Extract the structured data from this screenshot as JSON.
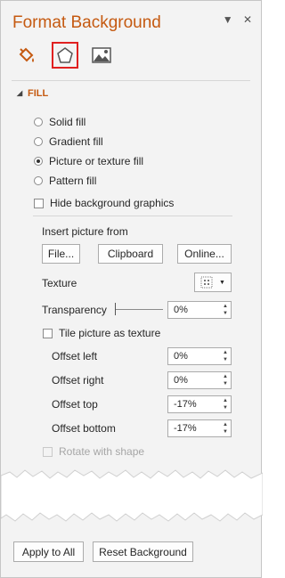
{
  "pane": {
    "title": "Format Background",
    "options_icon": "▼",
    "close_icon": "✕"
  },
  "tabs": [
    {
      "name": "fill",
      "icon": "paint-bucket-icon"
    },
    {
      "name": "effects",
      "icon": "pentagon-icon",
      "selected": true
    },
    {
      "name": "picture",
      "icon": "picture-icon"
    }
  ],
  "fill": {
    "section_label": "FILL",
    "collapse_icon": "◢",
    "options": [
      {
        "label": "Solid fill",
        "checked": false
      },
      {
        "label": "Gradient fill",
        "checked": false
      },
      {
        "label": "Picture or texture fill",
        "checked": true
      },
      {
        "label": "Pattern fill",
        "checked": false
      }
    ],
    "hide_graphics": "Hide background graphics",
    "insert_label": "Insert picture from",
    "file_btn": "File...",
    "clipboard_btn": "Clipboard",
    "online_btn": "Online...",
    "texture_label": "Texture",
    "transparency_label": "Transparency",
    "transparency_value": "0%",
    "transparency_level": 0,
    "tile_label": "Tile picture as texture",
    "offsets": [
      {
        "label": "Offset left",
        "value": "0%"
      },
      {
        "label": "Offset right",
        "value": "0%"
      },
      {
        "label": "Offset top",
        "value": "-17%"
      },
      {
        "label": "Offset bottom",
        "value": "-17%"
      }
    ],
    "rotate_label": "Rotate with shape"
  },
  "footer": {
    "apply_all": "Apply to All",
    "reset": "Reset Background"
  }
}
